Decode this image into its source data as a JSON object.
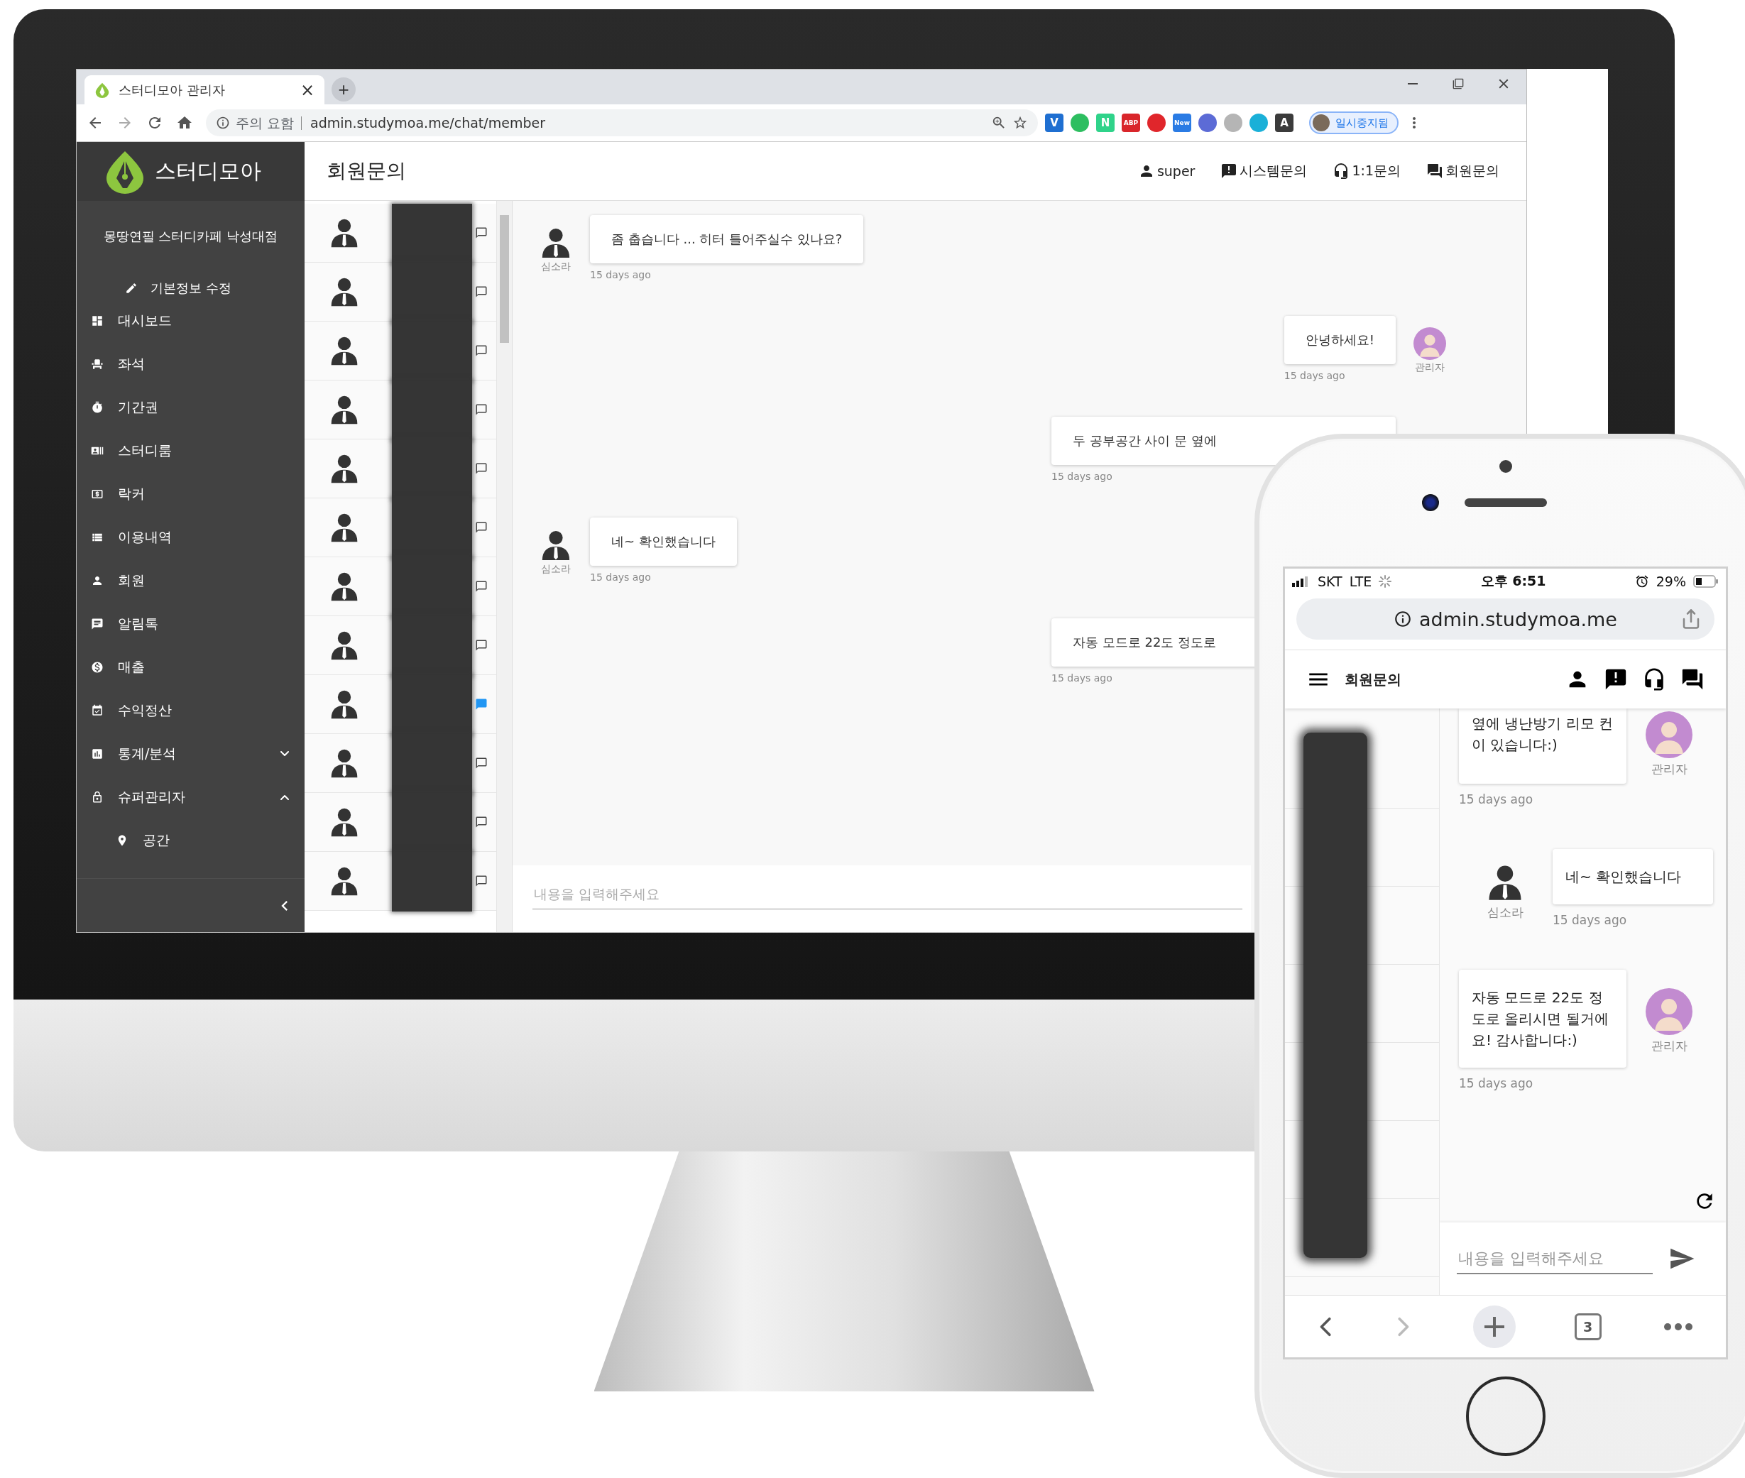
{
  "browser": {
    "tab": {
      "title": "스터디모아 관리자",
      "close": "×"
    },
    "new_tab": "+",
    "address": {
      "security": "주의 요함",
      "url": "admin.studymoa.me/chat/member"
    },
    "extensions": [
      {
        "kind": "letter",
        "label": "V",
        "color": "#1f6fd1"
      },
      {
        "kind": "shape",
        "color": "#2dbe60"
      },
      {
        "kind": "letter",
        "label": "N",
        "color": "#2fd38a"
      },
      {
        "kind": "letter",
        "label": "ABP",
        "color": "#d9262b"
      },
      {
        "kind": "shape",
        "color": "#e0262b"
      },
      {
        "kind": "letter",
        "label": "New",
        "color": "#2a7be4"
      },
      {
        "kind": "shape",
        "color": "#5c6bd6"
      },
      {
        "kind": "shape",
        "color": "#b5b5b5"
      },
      {
        "kind": "shape",
        "color": "#1ab0d8"
      },
      {
        "kind": "letter",
        "label": "A",
        "color": "#3b3b3b"
      }
    ],
    "profile": {
      "label": "일시중지됨"
    }
  },
  "app": {
    "logo": "스터디모아",
    "page_title": "회원문의",
    "nav": [
      {
        "label": "super"
      },
      {
        "label": "시스템문의"
      },
      {
        "label": "1:1문의"
      },
      {
        "label": "회원문의"
      }
    ],
    "store_name": "몽땅연필 스터디카페 낙성대점",
    "edit_link": "기본정보 수정",
    "menu": [
      {
        "kind": "link",
        "label": "대시보드"
      },
      {
        "kind": "link",
        "label": "좌석"
      },
      {
        "kind": "link",
        "label": "기간권"
      },
      {
        "kind": "link",
        "label": "스터디룸"
      },
      {
        "kind": "link",
        "label": "락커"
      },
      {
        "kind": "link",
        "label": "이용내역"
      },
      {
        "kind": "link",
        "label": "회원"
      },
      {
        "kind": "link",
        "label": "알림톡"
      },
      {
        "kind": "link",
        "label": "매출"
      },
      {
        "kind": "link",
        "label": "수익정산"
      },
      {
        "kind": "group",
        "label": "통계/분석",
        "expanded": false
      },
      {
        "kind": "group",
        "label": "슈퍼관리자",
        "expanded": true,
        "children": [
          {
            "label": "공간"
          }
        ]
      }
    ],
    "members": [
      {
        "unread": false
      },
      {
        "unread": false
      },
      {
        "unread": false
      },
      {
        "unread": false
      },
      {
        "unread": false
      },
      {
        "unread": false
      },
      {
        "unread": false
      },
      {
        "unread": false
      },
      {
        "unread": true
      },
      {
        "unread": false
      },
      {
        "unread": false
      },
      {
        "unread": false
      }
    ],
    "chat": {
      "messages": [
        {
          "kind": "received",
          "sender": "심소라",
          "text": "좀 춥습니다 ... 히터 틀어주실수 있나요?",
          "time": "15 days ago",
          "covered": false
        },
        {
          "kind": "sent",
          "sender": "관리자",
          "text": "안녕하세요!",
          "time": "15 days ago",
          "covered": false
        },
        {
          "kind": "sent",
          "text": "두 공부공간 사이 문 옆에",
          "time": "15 days ago",
          "covered": true
        },
        {
          "kind": "received",
          "sender": "심소라",
          "text": "네~ 확인했습니다",
          "time": "15 days ago",
          "covered": false
        },
        {
          "kind": "sent",
          "text": "자동 모드로 22도 정도로",
          "time": "15 days ago",
          "covered": true
        }
      ],
      "input": {
        "placeholder": "내용을 입력해주세요"
      }
    }
  },
  "phone": {
    "status": {
      "carrier": "SKT",
      "network": "LTE",
      "time": "오후 6:51",
      "battery": "29%"
    },
    "url": "admin.studymoa.me",
    "page_title": "회원문의",
    "messages": [
      {
        "kind": "sent",
        "sender": "관리자",
        "text": "옆에 냉난방기 리모 컨이 있습니다:)",
        "time": "15 days ago",
        "covered": true
      },
      {
        "kind": "received",
        "sender": "심소라",
        "text": "네~ 확인했습니다",
        "time": "15 days ago",
        "covered": false
      },
      {
        "kind": "sent",
        "sender": "관리자",
        "text": "자동 모드로 22도 정도로 올리시면 될거에요! 감사합니다:)",
        "time": "15 days ago",
        "covered": false
      }
    ],
    "input": {
      "placeholder": "내용을 입력해주세요"
    },
    "tab_count": "3"
  }
}
